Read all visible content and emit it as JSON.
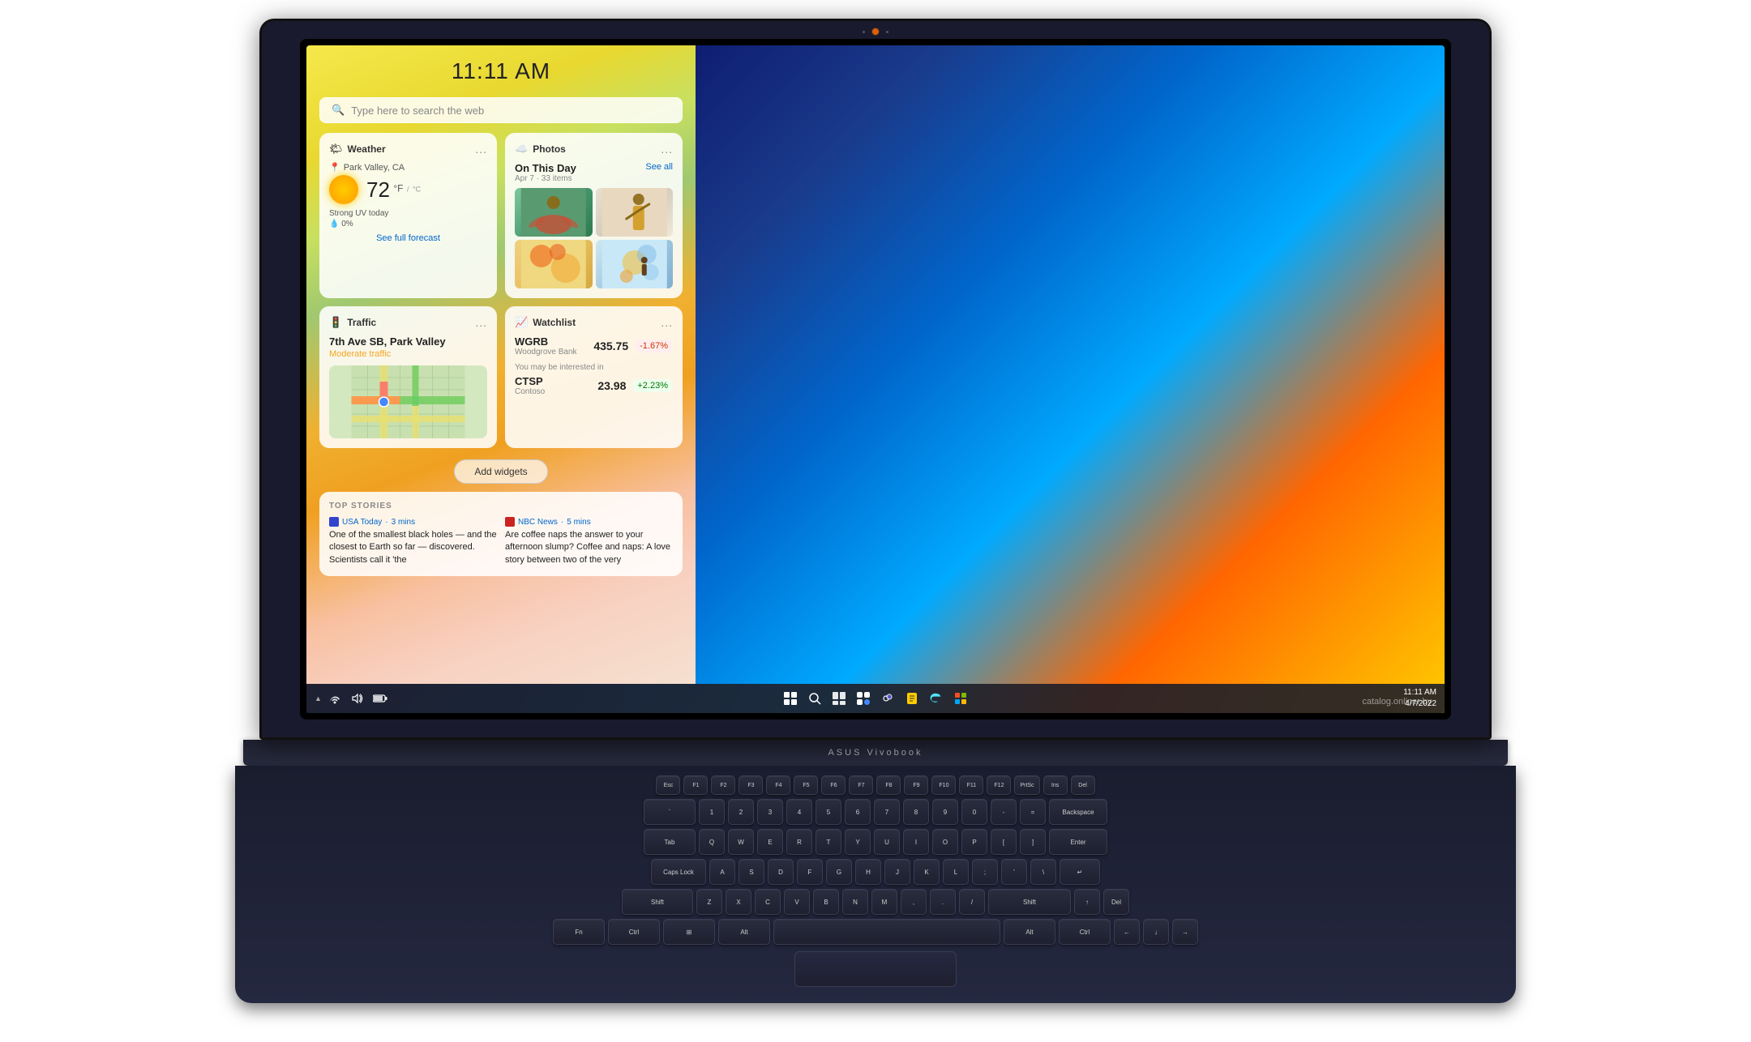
{
  "laptop": {
    "brand": "ASUS Vivobook"
  },
  "screen": {
    "time": "11:11 AM",
    "search_placeholder": "Type here to search the web"
  },
  "widgets": {
    "weather": {
      "title": "Weather",
      "location": "Park Valley, CA",
      "temp": "72",
      "temp_unit": "°F",
      "temp_unit_secondary": "°C",
      "uv": "Strong UV today",
      "rain": "💧 0%",
      "forecast_link": "See full forecast",
      "more_icon": "..."
    },
    "photos": {
      "title": "Photos",
      "on_this_day": "On This Day",
      "date": "Apr 7",
      "items_count": "33 items",
      "see_all": "See all",
      "more_icon": "..."
    },
    "traffic": {
      "title": "Traffic",
      "address": "7th Ave SB, Park Valley",
      "status": "Moderate traffic",
      "more_icon": "..."
    },
    "watchlist": {
      "title": "Watchlist",
      "more_icon": "...",
      "stock1": {
        "ticker": "WGRB",
        "name": "Woodgrove Bank",
        "price": "435.75",
        "change": "-1.67%"
      },
      "interest_label": "You may be interested in",
      "stock2": {
        "ticker": "CTSP",
        "name": "Contoso",
        "price": "23.98",
        "change": "+2.23%"
      }
    },
    "add_button": "Add widgets"
  },
  "top_stories": {
    "label": "TOP STORIES",
    "story1": {
      "source": "USA Today",
      "time": "3 mins",
      "text": "One of the smallest black holes — and the closest to Earth so far — discovered. Scientists call it 'the"
    },
    "story2": {
      "source": "NBC News",
      "time": "5 mins",
      "text": "Are coffee naps the answer to your afternoon slump? Coffee and naps: A love story between two of the very"
    }
  },
  "taskbar": {
    "clock_time": "11:11 AM",
    "clock_date": "4/7/2022",
    "icons": [
      "start",
      "search",
      "taskview",
      "widgets",
      "chat",
      "notes",
      "edge",
      "store"
    ]
  },
  "watermark": "catalog.onliner.by"
}
